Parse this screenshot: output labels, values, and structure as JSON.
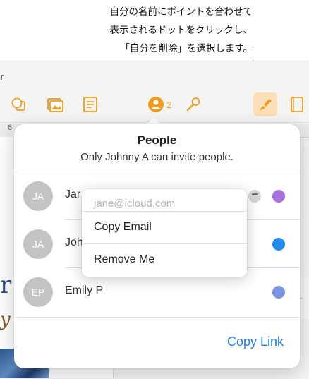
{
  "callout": {
    "line1": "自分の名前にポイントを合わせて",
    "line2": "表示されるドットをクリックし、",
    "line3": "「自分を削除」を選択します。"
  },
  "app": {
    "title_fragment": "r",
    "collaborator_count": "2",
    "ruler_number": "6",
    "accent_color": "#F29C1F"
  },
  "doc": {
    "letter_r": "r",
    "letter_y": "y"
  },
  "popover": {
    "title": "People",
    "subtitle": "Only Johnny A can invite people.",
    "copy_link_label": "Copy Link",
    "people": [
      {
        "initials": "JA",
        "name": "Jar",
        "color": "#A970E0"
      },
      {
        "initials": "JA",
        "name": "Joh",
        "color": "#1E8CF0"
      },
      {
        "initials": "EP",
        "name": "Emily P",
        "color": "#7B96E0"
      }
    ],
    "more_glyph": "•••"
  },
  "menu": {
    "email": "jane@icloud.com",
    "copy_email": "Copy Email",
    "remove_me": "Remove Me"
  }
}
